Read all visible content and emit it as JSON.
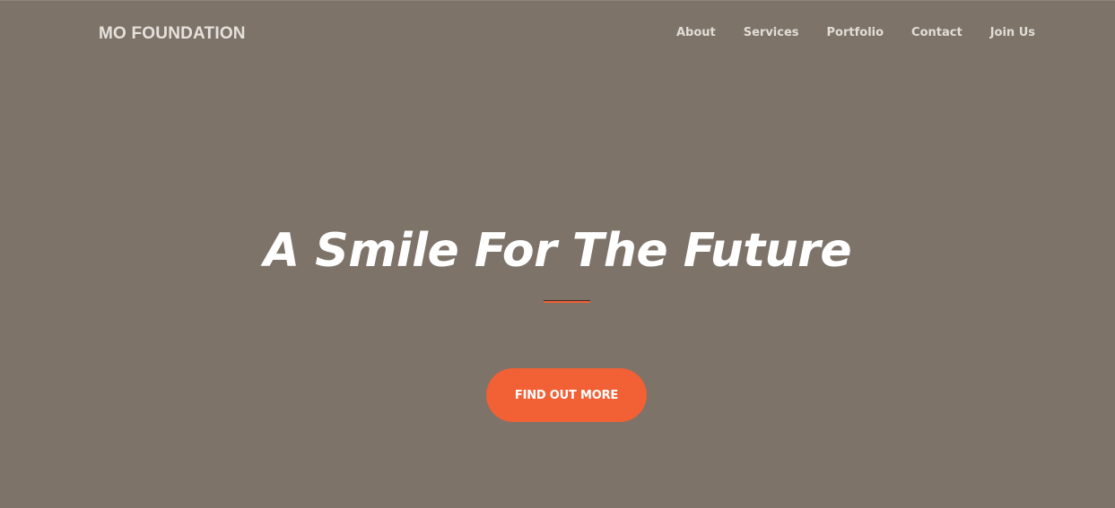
{
  "header": {
    "brand": "MO FOUNDATION",
    "nav": [
      {
        "label": "About"
      },
      {
        "label": "Services"
      },
      {
        "label": "Portfolio"
      },
      {
        "label": "Contact"
      },
      {
        "label": "Join Us"
      }
    ]
  },
  "hero": {
    "title": "A Smile For The Future",
    "cta_label": "FIND OUT MORE"
  },
  "colors": {
    "background": "#7d7369",
    "accent": "#f26035",
    "text": "#ffffff"
  }
}
